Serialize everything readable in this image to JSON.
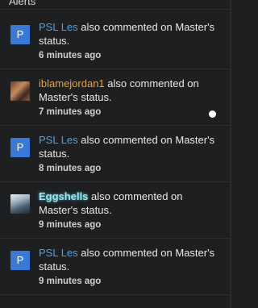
{
  "header": {
    "title": "Alerts"
  },
  "alerts": [
    {
      "avatar": {
        "type": "letter",
        "letter": "P"
      },
      "user": "PSL Les",
      "message": "also commented on Master's status.",
      "time": "6 minutes ago"
    },
    {
      "avatar": {
        "type": "photo"
      },
      "user": "iblamejordan1",
      "message": "also commented on Master's status.",
      "time": "7 minutes ago",
      "unread": true
    },
    {
      "avatar": {
        "type": "letter",
        "letter": "P"
      },
      "user": "PSL Les",
      "message": "also commented on Master's status.",
      "time": "8 minutes ago"
    },
    {
      "avatar": {
        "type": "photo"
      },
      "user": "Eggshells",
      "message": "also commented on Master's status.",
      "time": "9 minutes ago"
    },
    {
      "avatar": {
        "type": "letter",
        "letter": "P"
      },
      "user": "PSL Les",
      "message": "also commented on Master's status.",
      "time": "9 minutes ago"
    }
  ],
  "colors": {
    "background": "#1e1f21",
    "link_blue": "#4f9fe6",
    "username_orange": "#e8a23a",
    "username_cyan": "#9fe6f2",
    "avatar_blue": "#3a79d6"
  }
}
